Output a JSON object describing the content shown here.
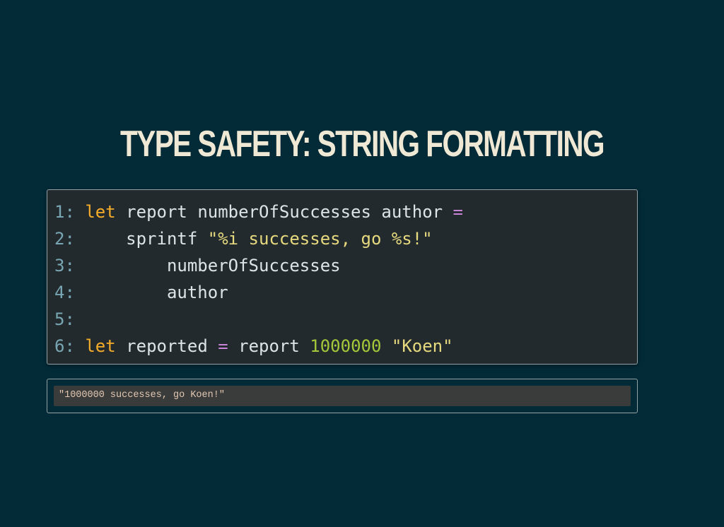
{
  "slide": {
    "title": "TYPE SAFETY: STRING FORMATTING"
  },
  "code": {
    "lines": [
      {
        "number": "1:",
        "tokens": [
          {
            "text": " ",
            "type": "id"
          },
          {
            "text": "let",
            "type": "kw"
          },
          {
            "text": " report numberOfSuccesses author ",
            "type": "id"
          },
          {
            "text": "=",
            "type": "op"
          }
        ]
      },
      {
        "number": "2:",
        "tokens": [
          {
            "text": "     sprintf ",
            "type": "id"
          },
          {
            "text": "\"%i successes, go %s!\"",
            "type": "str"
          }
        ]
      },
      {
        "number": "3:",
        "tokens": [
          {
            "text": "         numberOfSuccesses",
            "type": "id"
          }
        ]
      },
      {
        "number": "4:",
        "tokens": [
          {
            "text": "         author",
            "type": "id"
          }
        ]
      },
      {
        "number": "5:",
        "tokens": []
      },
      {
        "number": "6:",
        "tokens": [
          {
            "text": " ",
            "type": "id"
          },
          {
            "text": "let",
            "type": "kw"
          },
          {
            "text": " reported ",
            "type": "id"
          },
          {
            "text": "=",
            "type": "op"
          },
          {
            "text": " report ",
            "type": "id"
          },
          {
            "text": "1000000",
            "type": "num"
          },
          {
            "text": " ",
            "type": "id"
          },
          {
            "text": "\"Koen\"",
            "type": "str"
          }
        ]
      }
    ]
  },
  "output": {
    "text": "\"1000000 successes, go Koen!\""
  },
  "colors": {
    "background": "#022a37",
    "code_background": "#232a2e",
    "keyword": "#f6ad2a",
    "operator": "#c984d8",
    "string": "#e6d97e",
    "number": "#a3c93a",
    "line_number": "#79a6b3"
  }
}
